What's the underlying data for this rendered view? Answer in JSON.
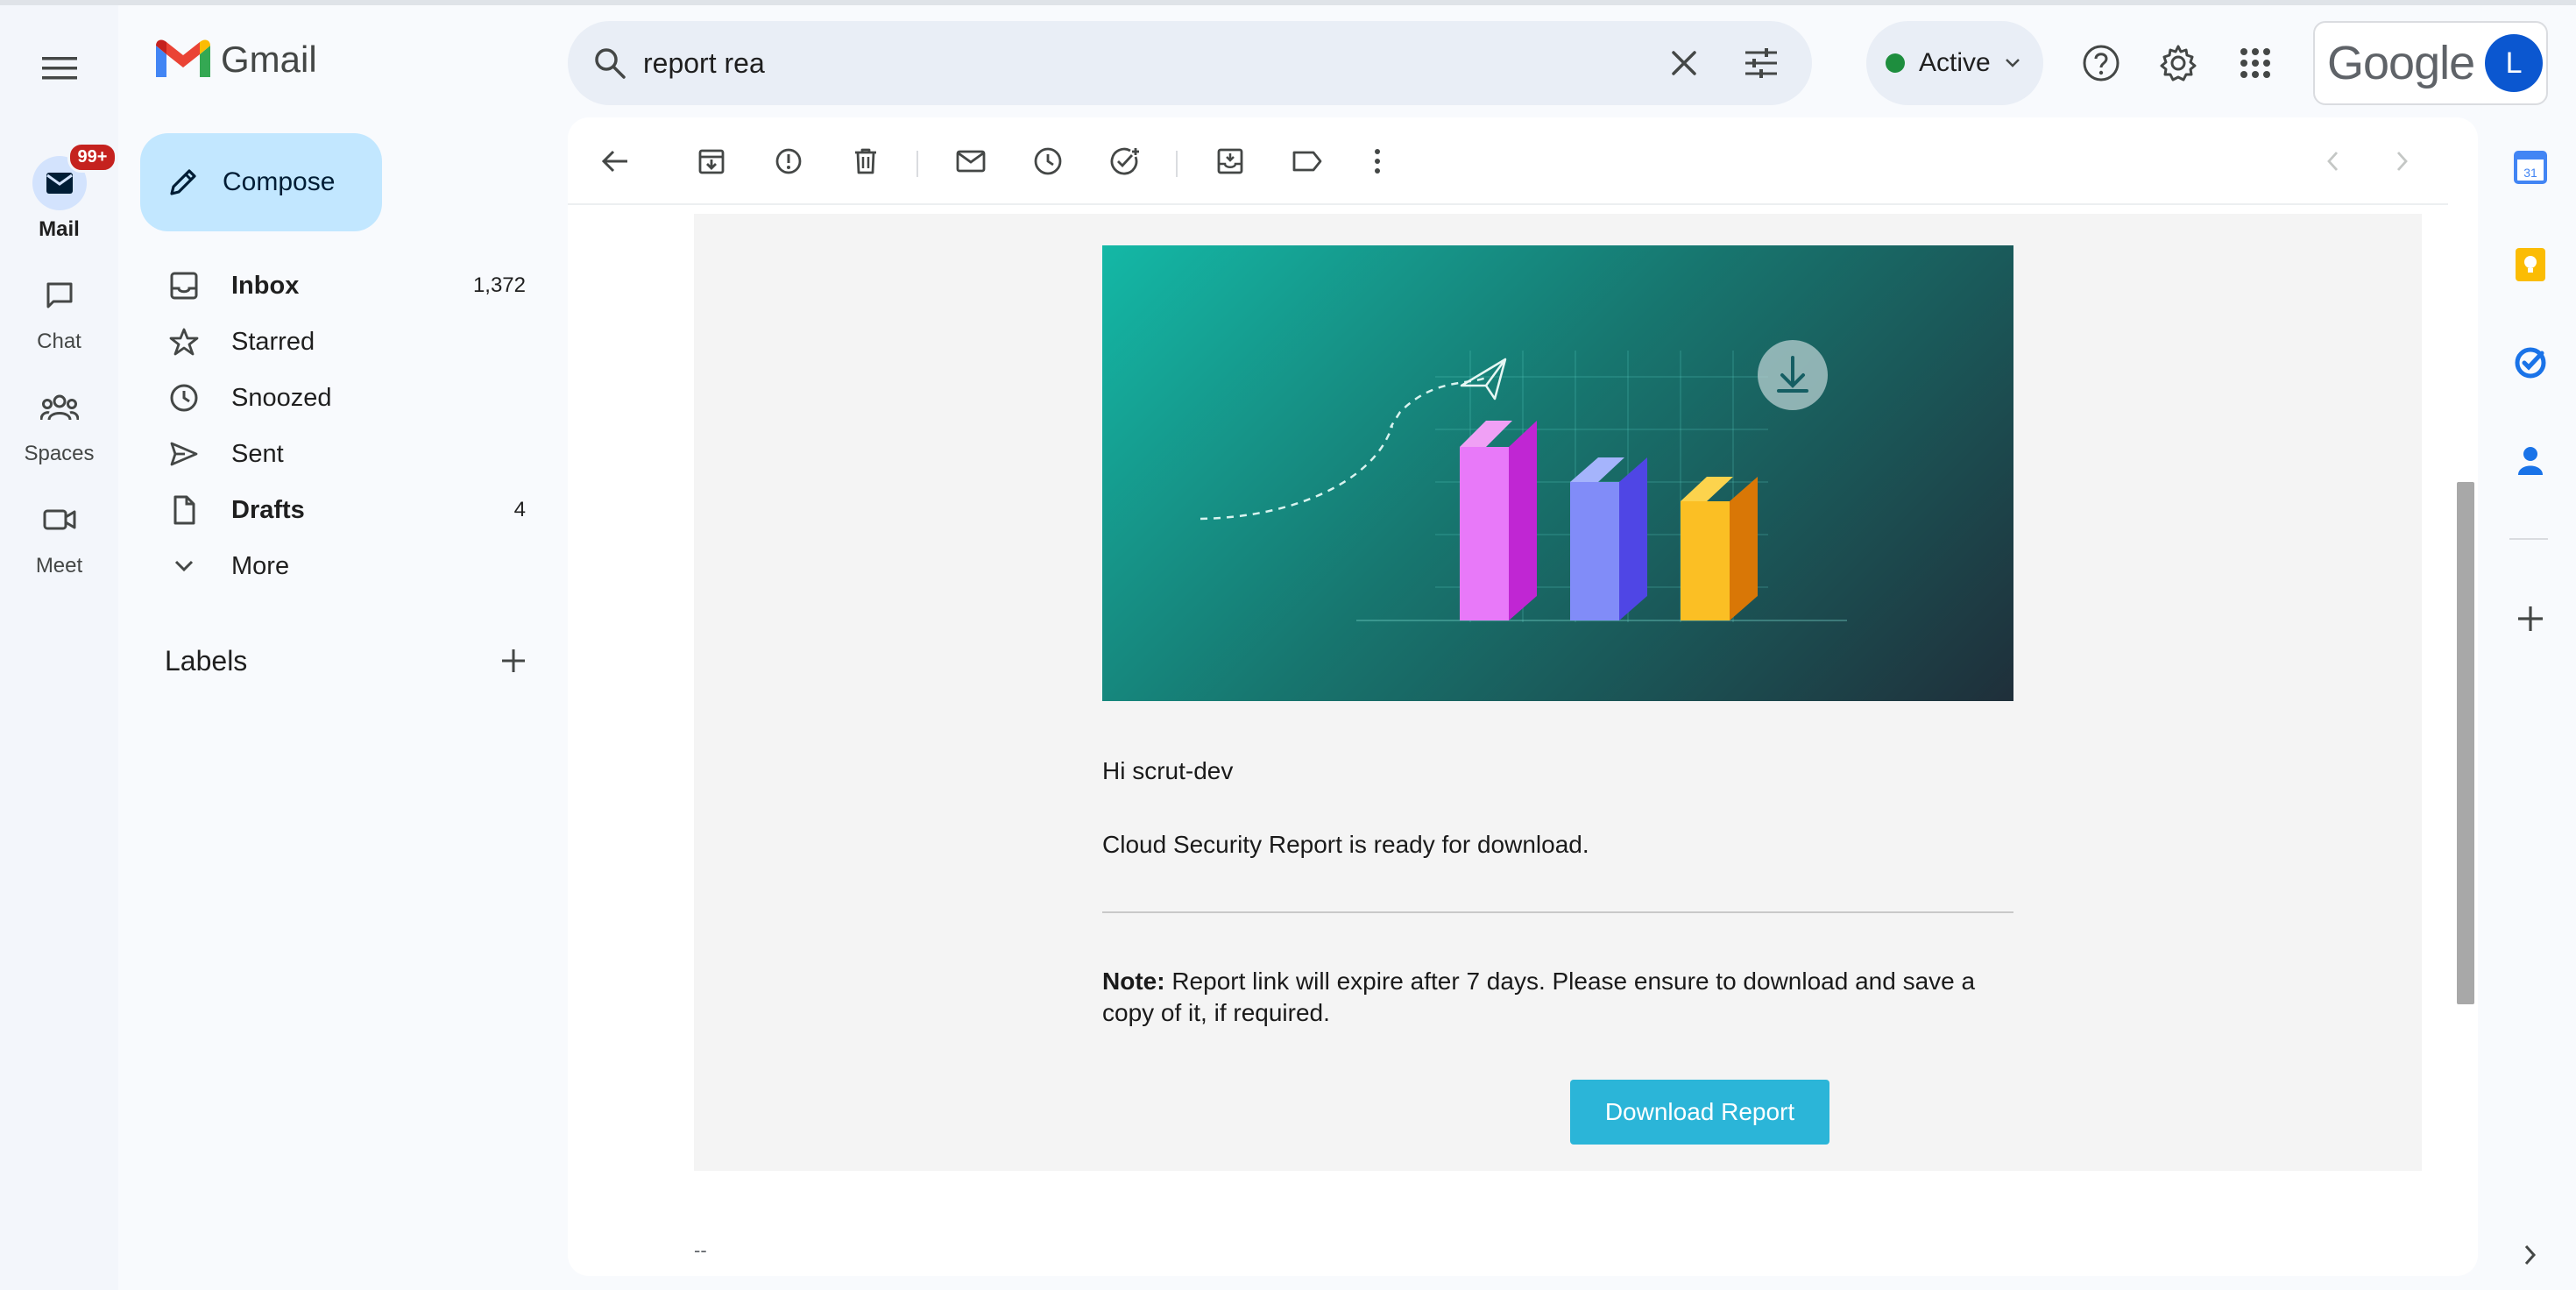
{
  "app": {
    "name": "Gmail"
  },
  "rail": {
    "items": [
      {
        "label": "Mail",
        "badge": "99+",
        "icon": "mail-icon",
        "active": true
      },
      {
        "label": "Chat",
        "icon": "chat-icon"
      },
      {
        "label": "Spaces",
        "icon": "spaces-icon"
      },
      {
        "label": "Meet",
        "icon": "video-icon"
      }
    ]
  },
  "search": {
    "value": "report rea",
    "placeholder": "Search mail"
  },
  "status": {
    "label": "Active",
    "color": "#1e8e3e"
  },
  "account": {
    "brand": "Google",
    "initial": "L",
    "avatar_color": "#0b57d0"
  },
  "compose": {
    "label": "Compose"
  },
  "nav": {
    "items": [
      {
        "label": "Inbox",
        "count": "1,372",
        "icon": "inbox-icon",
        "bold": true
      },
      {
        "label": "Starred",
        "count": "",
        "icon": "star-icon"
      },
      {
        "label": "Snoozed",
        "count": "",
        "icon": "clock-icon"
      },
      {
        "label": "Sent",
        "count": "",
        "icon": "send-icon"
      },
      {
        "label": "Drafts",
        "count": "4",
        "icon": "draft-icon",
        "bold": true
      },
      {
        "label": "More",
        "count": "",
        "icon": "chevron-down-icon"
      }
    ]
  },
  "labels": {
    "title": "Labels"
  },
  "email": {
    "greeting": "Hi scrut-dev",
    "message": "Cloud Security Report is ready for download.",
    "note_label": "Note:",
    "note_text": " Report link will expire after 7 days. Please ensure to download and save a copy of it, if required.",
    "button": "Download Report",
    "signature": "--"
  },
  "colors": {
    "accent": "#0b57d0",
    "compose_bg": "#c2e7ff",
    "download_button": "#2bb5d8"
  }
}
